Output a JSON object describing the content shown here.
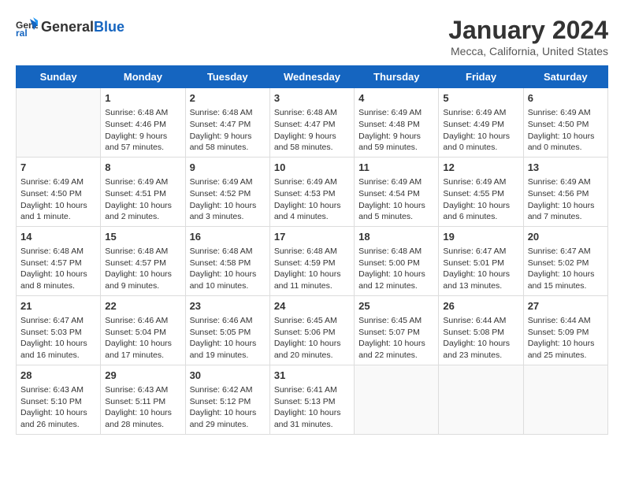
{
  "header": {
    "logo_general": "General",
    "logo_blue": "Blue",
    "title": "January 2024",
    "subtitle": "Mecca, California, United States"
  },
  "days_of_week": [
    "Sunday",
    "Monday",
    "Tuesday",
    "Wednesday",
    "Thursday",
    "Friday",
    "Saturday"
  ],
  "weeks": [
    [
      {
        "day": "",
        "info": ""
      },
      {
        "day": "1",
        "info": "Sunrise: 6:48 AM\nSunset: 4:46 PM\nDaylight: 9 hours\nand 57 minutes."
      },
      {
        "day": "2",
        "info": "Sunrise: 6:48 AM\nSunset: 4:47 PM\nDaylight: 9 hours\nand 58 minutes."
      },
      {
        "day": "3",
        "info": "Sunrise: 6:48 AM\nSunset: 4:47 PM\nDaylight: 9 hours\nand 58 minutes."
      },
      {
        "day": "4",
        "info": "Sunrise: 6:49 AM\nSunset: 4:48 PM\nDaylight: 9 hours\nand 59 minutes."
      },
      {
        "day": "5",
        "info": "Sunrise: 6:49 AM\nSunset: 4:49 PM\nDaylight: 10 hours\nand 0 minutes."
      },
      {
        "day": "6",
        "info": "Sunrise: 6:49 AM\nSunset: 4:50 PM\nDaylight: 10 hours\nand 0 minutes."
      }
    ],
    [
      {
        "day": "7",
        "info": "Sunrise: 6:49 AM\nSunset: 4:50 PM\nDaylight: 10 hours\nand 1 minute."
      },
      {
        "day": "8",
        "info": "Sunrise: 6:49 AM\nSunset: 4:51 PM\nDaylight: 10 hours\nand 2 minutes."
      },
      {
        "day": "9",
        "info": "Sunrise: 6:49 AM\nSunset: 4:52 PM\nDaylight: 10 hours\nand 3 minutes."
      },
      {
        "day": "10",
        "info": "Sunrise: 6:49 AM\nSunset: 4:53 PM\nDaylight: 10 hours\nand 4 minutes."
      },
      {
        "day": "11",
        "info": "Sunrise: 6:49 AM\nSunset: 4:54 PM\nDaylight: 10 hours\nand 5 minutes."
      },
      {
        "day": "12",
        "info": "Sunrise: 6:49 AM\nSunset: 4:55 PM\nDaylight: 10 hours\nand 6 minutes."
      },
      {
        "day": "13",
        "info": "Sunrise: 6:49 AM\nSunset: 4:56 PM\nDaylight: 10 hours\nand 7 minutes."
      }
    ],
    [
      {
        "day": "14",
        "info": "Sunrise: 6:48 AM\nSunset: 4:57 PM\nDaylight: 10 hours\nand 8 minutes."
      },
      {
        "day": "15",
        "info": "Sunrise: 6:48 AM\nSunset: 4:57 PM\nDaylight: 10 hours\nand 9 minutes."
      },
      {
        "day": "16",
        "info": "Sunrise: 6:48 AM\nSunset: 4:58 PM\nDaylight: 10 hours\nand 10 minutes."
      },
      {
        "day": "17",
        "info": "Sunrise: 6:48 AM\nSunset: 4:59 PM\nDaylight: 10 hours\nand 11 minutes."
      },
      {
        "day": "18",
        "info": "Sunrise: 6:48 AM\nSunset: 5:00 PM\nDaylight: 10 hours\nand 12 minutes."
      },
      {
        "day": "19",
        "info": "Sunrise: 6:47 AM\nSunset: 5:01 PM\nDaylight: 10 hours\nand 13 minutes."
      },
      {
        "day": "20",
        "info": "Sunrise: 6:47 AM\nSunset: 5:02 PM\nDaylight: 10 hours\nand 15 minutes."
      }
    ],
    [
      {
        "day": "21",
        "info": "Sunrise: 6:47 AM\nSunset: 5:03 PM\nDaylight: 10 hours\nand 16 minutes."
      },
      {
        "day": "22",
        "info": "Sunrise: 6:46 AM\nSunset: 5:04 PM\nDaylight: 10 hours\nand 17 minutes."
      },
      {
        "day": "23",
        "info": "Sunrise: 6:46 AM\nSunset: 5:05 PM\nDaylight: 10 hours\nand 19 minutes."
      },
      {
        "day": "24",
        "info": "Sunrise: 6:45 AM\nSunset: 5:06 PM\nDaylight: 10 hours\nand 20 minutes."
      },
      {
        "day": "25",
        "info": "Sunrise: 6:45 AM\nSunset: 5:07 PM\nDaylight: 10 hours\nand 22 minutes."
      },
      {
        "day": "26",
        "info": "Sunrise: 6:44 AM\nSunset: 5:08 PM\nDaylight: 10 hours\nand 23 minutes."
      },
      {
        "day": "27",
        "info": "Sunrise: 6:44 AM\nSunset: 5:09 PM\nDaylight: 10 hours\nand 25 minutes."
      }
    ],
    [
      {
        "day": "28",
        "info": "Sunrise: 6:43 AM\nSunset: 5:10 PM\nDaylight: 10 hours\nand 26 minutes."
      },
      {
        "day": "29",
        "info": "Sunrise: 6:43 AM\nSunset: 5:11 PM\nDaylight: 10 hours\nand 28 minutes."
      },
      {
        "day": "30",
        "info": "Sunrise: 6:42 AM\nSunset: 5:12 PM\nDaylight: 10 hours\nand 29 minutes."
      },
      {
        "day": "31",
        "info": "Sunrise: 6:41 AM\nSunset: 5:13 PM\nDaylight: 10 hours\nand 31 minutes."
      },
      {
        "day": "",
        "info": ""
      },
      {
        "day": "",
        "info": ""
      },
      {
        "day": "",
        "info": ""
      }
    ]
  ]
}
